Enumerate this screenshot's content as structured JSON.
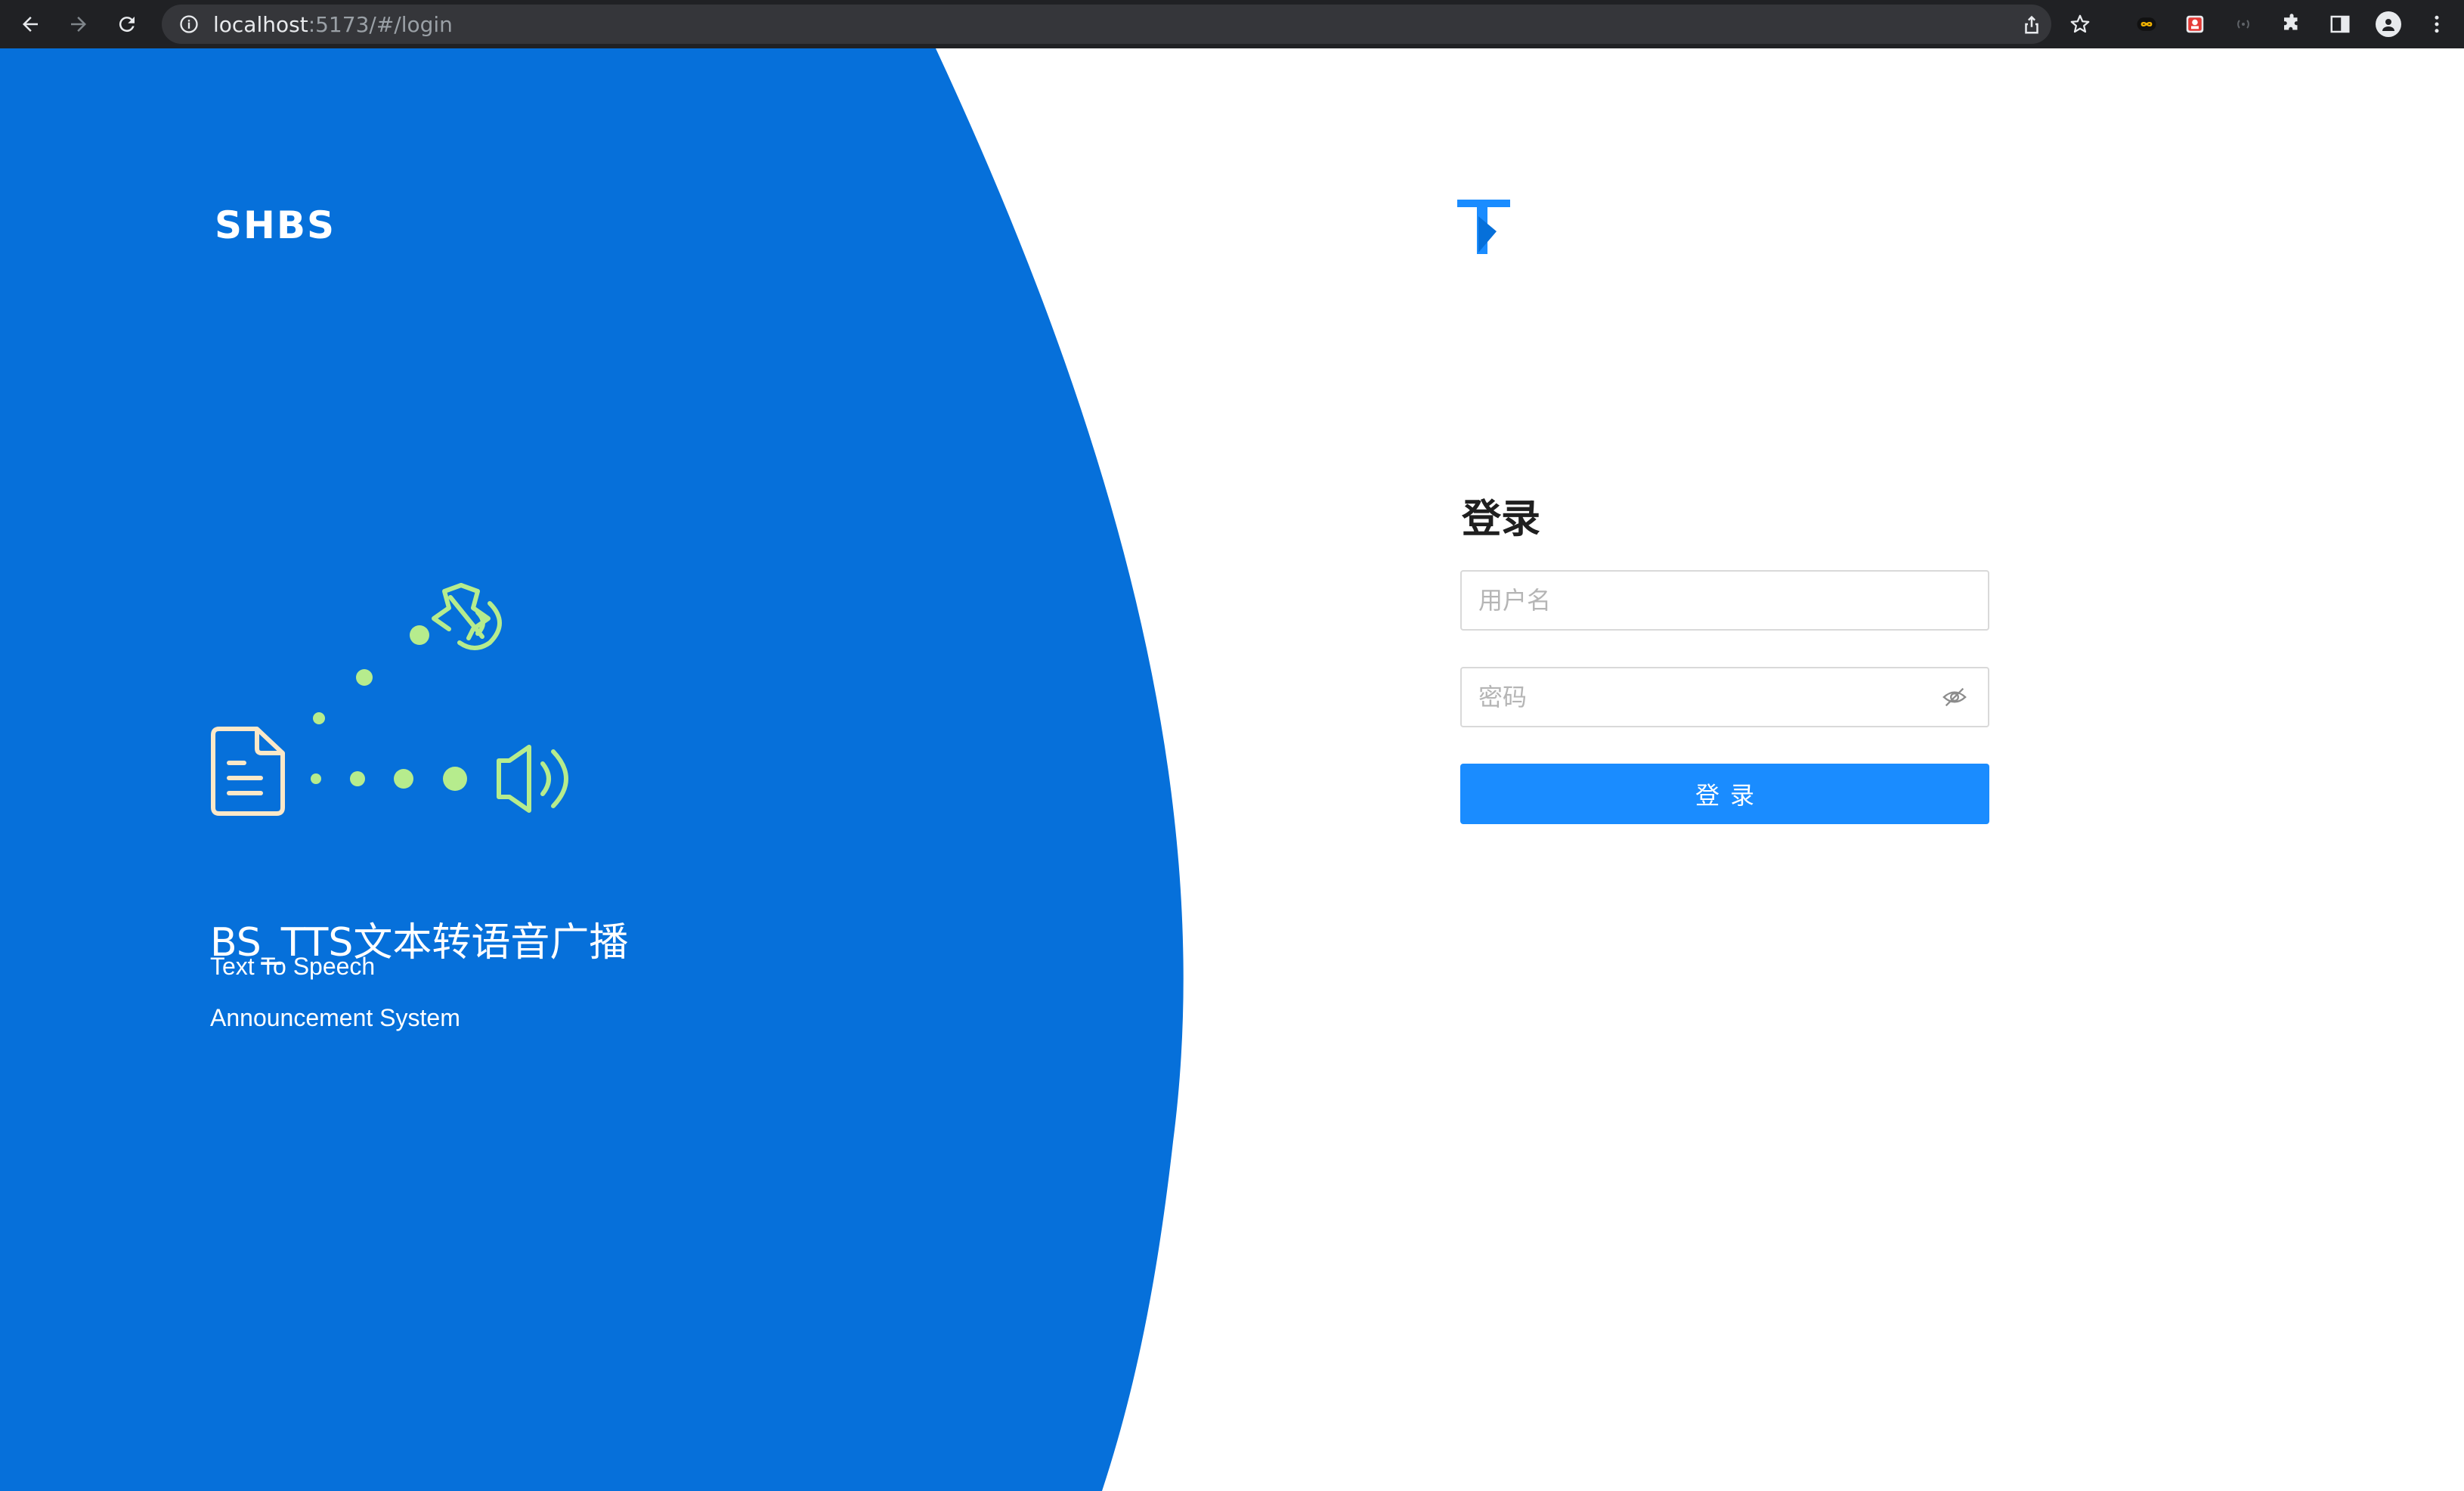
{
  "browser": {
    "url_host": "localhost",
    "url_rest": ":5173/#/login",
    "icons": [
      "back-icon",
      "forward-icon",
      "reload-icon",
      "info-icon",
      "share-icon",
      "star-icon",
      "extension-icon",
      "puzzle-icon",
      "sidepanel-icon",
      "profile-icon",
      "menu-icon"
    ]
  },
  "hero": {
    "brand": "SHBS",
    "product_title": "BS_TTS文本转语音广播",
    "subtitle_line1": "Text To Speech",
    "subtitle_line2": "Announcement System"
  },
  "login": {
    "heading": "登录",
    "username_placeholder": "用户名",
    "password_placeholder": "密码",
    "submit_label": "登录"
  },
  "colors": {
    "hero_blue": "#0670da",
    "button_blue": "#1a8cff",
    "illustration_green": "#b6ec8d",
    "illustration_cream": "#fbe8c8"
  }
}
